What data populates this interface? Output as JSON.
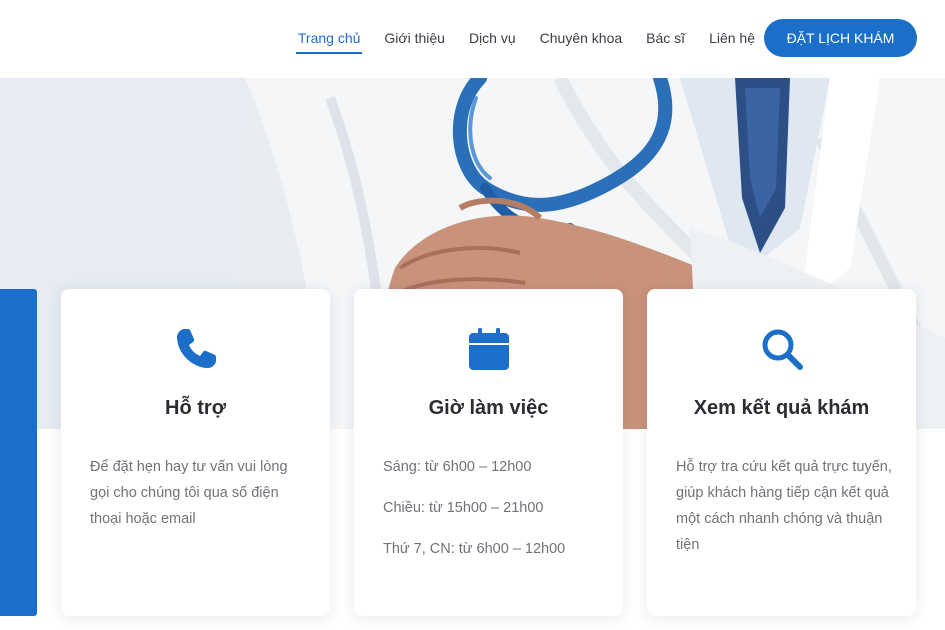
{
  "nav": {
    "items": [
      {
        "label": "Trang chủ",
        "active": true
      },
      {
        "label": "Giới thiệu"
      },
      {
        "label": "Dịch vụ"
      },
      {
        "label": "Chuyên khoa"
      },
      {
        "label": "Bác sĩ"
      },
      {
        "label": "Liên hệ"
      }
    ],
    "cta_label": "ĐẶT LỊCH KHÁM"
  },
  "colors": {
    "accent": "#1c6fc9",
    "title": "#2a2d31",
    "body_text": "#707378"
  },
  "cards": [
    {
      "icon": "phone-icon",
      "title": "Hỗ trợ",
      "text": "Để đặt hẹn hay tư vấn vui lòng gọi cho chúng tôi qua số điện thoại hoặc email"
    },
    {
      "icon": "calendar-icon",
      "title": "Giờ làm việc",
      "lines": [
        "Sáng: từ 6h00 – 12h00",
        "Chiều: từ 15h00 – 21h00",
        "Thứ 7, CN: từ 6h00 – 12h00"
      ]
    },
    {
      "icon": "search-icon",
      "title": "Xem kết quả khám",
      "text": "Hỗ trợ tra cứu kết quả trực tuyến, giúp khách hàng tiếp cận kết quả một cách nhanh chóng và thuận tiện"
    }
  ]
}
